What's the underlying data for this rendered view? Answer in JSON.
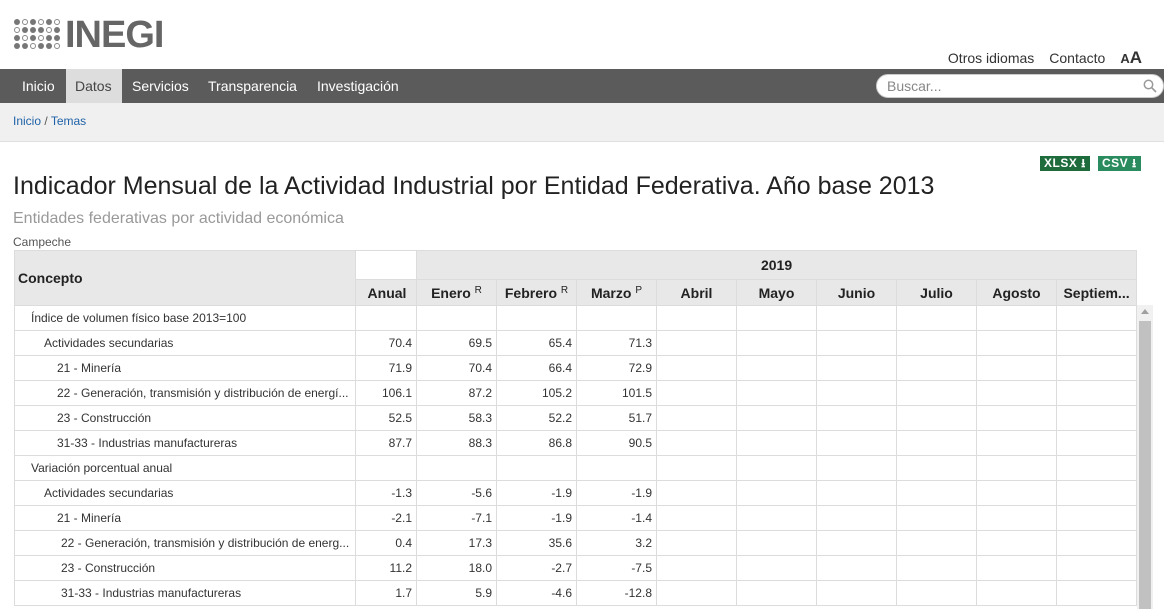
{
  "logo": {
    "text": "INEGI"
  },
  "toplinks": {
    "languages": "Otros idiomas",
    "contact": "Contacto",
    "font_small": "A",
    "font_large": "A"
  },
  "nav": {
    "items": [
      "Inicio",
      "Datos",
      "Servicios",
      "Transparencia",
      "Investigación"
    ],
    "active": "Datos",
    "search_placeholder": "Buscar...",
    "search_icon": "search-icon"
  },
  "breadcrumb": {
    "home": "Inicio",
    "sep": "/",
    "current": "Temas"
  },
  "downloads": {
    "xlsx": "XLSX",
    "csv": "CSV"
  },
  "title": "Indicador Mensual de la Actividad Industrial por Entidad Federativa. Año base 2013",
  "subtitle": "Entidades federativas por actividad económica",
  "entity": "Campeche",
  "table": {
    "concept_header": "Concepto",
    "year": "2019",
    "columns": {
      "anual": "Anual",
      "ene": "Enero",
      "ene_flag": "R",
      "feb": "Febrero",
      "feb_flag": "R",
      "mar": "Marzo",
      "mar_flag": "P",
      "abr": "Abril",
      "may": "Mayo",
      "jun": "Junio",
      "jul": "Julio",
      "ago": "Agosto",
      "sep": "Septiem..."
    },
    "rows": [
      {
        "label": "Índice de volumen físico base 2013=100",
        "values": [
          "",
          "",
          "",
          ""
        ]
      },
      {
        "label": "Actividades secundarias",
        "values": [
          "70.4",
          "69.5",
          "65.4",
          "71.3"
        ]
      },
      {
        "label": "21 - Minería",
        "values": [
          "71.9",
          "70.4",
          "66.4",
          "72.9"
        ]
      },
      {
        "label": "22 - Generación, transmisión y distribución de energí...",
        "values": [
          "106.1",
          "87.2",
          "105.2",
          "101.5"
        ]
      },
      {
        "label": "23 - Construcción",
        "values": [
          "52.5",
          "58.3",
          "52.2",
          "51.7"
        ]
      },
      {
        "label": "31-33 - Industrias manufactureras",
        "values": [
          "87.7",
          "88.3",
          "86.8",
          "90.5"
        ]
      },
      {
        "label": "Variación porcentual anual",
        "values": [
          "",
          "",
          "",
          ""
        ]
      },
      {
        "label": "Actividades secundarias",
        "values": [
          "-1.3",
          "-5.6",
          "-1.9",
          "-1.9"
        ]
      },
      {
        "label": "21 - Minería",
        "values": [
          "-2.1",
          "-7.1",
          "-1.9",
          "-1.4"
        ]
      },
      {
        "label": "22 - Generación, transmisión y distribución de energ...",
        "values": [
          "0.4",
          "17.3",
          "35.6",
          "3.2"
        ]
      },
      {
        "label": "23 - Construcción",
        "values": [
          "11.2",
          "18.0",
          "-2.7",
          "-7.5"
        ]
      },
      {
        "label": "31-33 - Industrias manufactureras",
        "values": [
          "1.7",
          "5.9",
          "-4.6",
          "-12.8"
        ]
      }
    ]
  }
}
